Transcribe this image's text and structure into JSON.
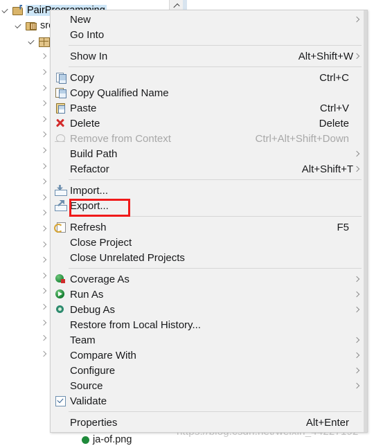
{
  "tree": {
    "name": "package-explorer-tree",
    "rows": [
      {
        "indent": 0,
        "expander": "open",
        "icon": "java-project-icon",
        "label": "PairProgramming",
        "selected": true
      },
      {
        "indent": 19,
        "expander": "open",
        "icon": "source-folder-icon",
        "label": "src",
        "selected": false
      },
      {
        "indent": 38,
        "expander": "open",
        "icon": "package-icon",
        "label": "",
        "selected": false
      },
      {
        "indent": 56,
        "expander": "closed",
        "icon": "",
        "label": "",
        "selected": false
      },
      {
        "indent": 56,
        "expander": "closed",
        "icon": "",
        "label": "",
        "selected": false
      },
      {
        "indent": 56,
        "expander": "closed",
        "icon": "",
        "label": "",
        "selected": false
      },
      {
        "indent": 56,
        "expander": "closed",
        "icon": "",
        "label": "",
        "selected": false
      },
      {
        "indent": 56,
        "expander": "closed",
        "icon": "",
        "label": "",
        "selected": false
      },
      {
        "indent": 56,
        "expander": "closed",
        "icon": "",
        "label": "",
        "selected": false
      },
      {
        "indent": 56,
        "expander": "closed",
        "icon": "",
        "label": "",
        "selected": false
      },
      {
        "indent": 56,
        "expander": "closed",
        "icon": "",
        "label": "",
        "selected": false
      },
      {
        "indent": 56,
        "expander": "closed",
        "icon": "",
        "label": "",
        "selected": false
      },
      {
        "indent": 56,
        "expander": "closed",
        "icon": "",
        "label": "",
        "selected": false
      },
      {
        "indent": 56,
        "expander": "closed",
        "icon": "",
        "label": "",
        "selected": false
      },
      {
        "indent": 56,
        "expander": "closed",
        "icon": "",
        "label": "",
        "selected": false
      },
      {
        "indent": 56,
        "expander": "closed",
        "icon": "",
        "label": "",
        "selected": false
      },
      {
        "indent": 56,
        "expander": "closed",
        "icon": "",
        "label": "",
        "selected": false
      },
      {
        "indent": 56,
        "expander": "closed",
        "icon": "",
        "label": "",
        "selected": false
      },
      {
        "indent": 56,
        "expander": "closed",
        "icon": "",
        "label": "",
        "selected": false
      },
      {
        "indent": 56,
        "expander": "closed",
        "icon": "",
        "label": "",
        "selected": false
      },
      {
        "indent": 56,
        "expander": "closed",
        "icon": "",
        "label": "",
        "selected": false
      },
      {
        "indent": 56,
        "expander": "closed",
        "icon": "",
        "label": "",
        "selected": false
      },
      {
        "indent": 56,
        "expander": "closed",
        "icon": "",
        "label": "",
        "selected": false
      }
    ],
    "clipped_bottom_row_label": "ja-of.png"
  },
  "context_menu": {
    "name": "project-context-menu",
    "highlighted_item": "Export...",
    "highlight_color": "#f01a1a",
    "items": [
      {
        "type": "item",
        "name": "new",
        "icon": "",
        "label": "New",
        "accel": "",
        "submenu": true,
        "enabled": true
      },
      {
        "type": "item",
        "name": "go-into",
        "icon": "",
        "label": "Go Into",
        "accel": "",
        "submenu": false,
        "enabled": true
      },
      {
        "type": "separator",
        "name": "separator-1"
      },
      {
        "type": "item",
        "name": "show-in",
        "icon": "",
        "label": "Show In",
        "accel": "Alt+Shift+W",
        "submenu": true,
        "enabled": true
      },
      {
        "type": "separator",
        "name": "separator-2"
      },
      {
        "type": "item",
        "name": "copy",
        "icon": "copy-icon",
        "label": "Copy",
        "accel": "Ctrl+C",
        "submenu": false,
        "enabled": true
      },
      {
        "type": "item",
        "name": "copy-qualified-name",
        "icon": "copy-qualified-icon",
        "label": "Copy Qualified Name",
        "accel": "",
        "submenu": false,
        "enabled": true
      },
      {
        "type": "item",
        "name": "paste",
        "icon": "paste-icon",
        "label": "Paste",
        "accel": "Ctrl+V",
        "submenu": false,
        "enabled": true
      },
      {
        "type": "item",
        "name": "delete",
        "icon": "delete-icon",
        "label": "Delete",
        "accel": "Delete",
        "submenu": false,
        "enabled": true
      },
      {
        "type": "item",
        "name": "remove-from-context",
        "icon": "remove-context-icon",
        "label": "Remove from Context",
        "accel": "Ctrl+Alt+Shift+Down",
        "submenu": false,
        "enabled": false
      },
      {
        "type": "item",
        "name": "build-path",
        "icon": "",
        "label": "Build Path",
        "accel": "",
        "submenu": true,
        "enabled": true
      },
      {
        "type": "item",
        "name": "refactor",
        "icon": "",
        "label": "Refactor",
        "accel": "Alt+Shift+T",
        "submenu": true,
        "enabled": true
      },
      {
        "type": "separator",
        "name": "separator-3"
      },
      {
        "type": "item",
        "name": "import",
        "icon": "import-icon",
        "label": "Import...",
        "accel": "",
        "submenu": false,
        "enabled": true
      },
      {
        "type": "item",
        "name": "export",
        "icon": "export-icon",
        "label": "Export...",
        "accel": "",
        "submenu": false,
        "enabled": true
      },
      {
        "type": "separator",
        "name": "separator-4"
      },
      {
        "type": "item",
        "name": "refresh",
        "icon": "refresh-icon",
        "label": "Refresh",
        "accel": "F5",
        "submenu": false,
        "enabled": true
      },
      {
        "type": "item",
        "name": "close-project",
        "icon": "",
        "label": "Close Project",
        "accel": "",
        "submenu": false,
        "enabled": true
      },
      {
        "type": "item",
        "name": "close-unrelated-projects",
        "icon": "",
        "label": "Close Unrelated Projects",
        "accel": "",
        "submenu": false,
        "enabled": true
      },
      {
        "type": "separator",
        "name": "separator-5"
      },
      {
        "type": "item",
        "name": "coverage-as",
        "icon": "coverage-icon",
        "label": "Coverage As",
        "accel": "",
        "submenu": true,
        "enabled": true
      },
      {
        "type": "item",
        "name": "run-as",
        "icon": "run-icon",
        "label": "Run As",
        "accel": "",
        "submenu": true,
        "enabled": true
      },
      {
        "type": "item",
        "name": "debug-as",
        "icon": "debug-icon",
        "label": "Debug As",
        "accel": "",
        "submenu": true,
        "enabled": true
      },
      {
        "type": "item",
        "name": "restore-from-local-history",
        "icon": "",
        "label": "Restore from Local History...",
        "accel": "",
        "submenu": false,
        "enabled": true
      },
      {
        "type": "item",
        "name": "team",
        "icon": "",
        "label": "Team",
        "accel": "",
        "submenu": true,
        "enabled": true
      },
      {
        "type": "item",
        "name": "compare-with",
        "icon": "",
        "label": "Compare With",
        "accel": "",
        "submenu": true,
        "enabled": true
      },
      {
        "type": "item",
        "name": "configure",
        "icon": "",
        "label": "Configure",
        "accel": "",
        "submenu": true,
        "enabled": true
      },
      {
        "type": "item",
        "name": "source",
        "icon": "",
        "label": "Source",
        "accel": "",
        "submenu": true,
        "enabled": true
      },
      {
        "type": "item",
        "name": "validate",
        "icon": "validate-icon",
        "label": "Validate",
        "accel": "",
        "submenu": false,
        "enabled": true
      },
      {
        "type": "separator",
        "name": "separator-6"
      },
      {
        "type": "item",
        "name": "properties",
        "icon": "",
        "label": "Properties",
        "accel": "Alt+Enter",
        "submenu": false,
        "enabled": true
      }
    ]
  },
  "watermark": {
    "text": "https://blog.csdn.net/weixin_44227192"
  }
}
